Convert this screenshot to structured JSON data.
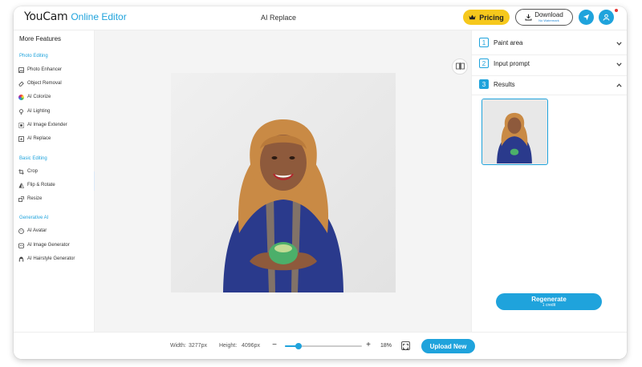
{
  "header": {
    "logo_brand": "YouCam",
    "logo_product": "Online Editor",
    "page_title": "AI Replace",
    "pricing_label": "Pricing",
    "download_label": "Download",
    "download_sub": "No Watermark"
  },
  "sidebar": {
    "title": "More Features",
    "sections": [
      {
        "label": "Photo Editing",
        "items": [
          {
            "label": "Photo Enhancer",
            "icon": "image-icon"
          },
          {
            "label": "Object Removal",
            "icon": "eraser-icon"
          },
          {
            "label": "AI Colorize",
            "icon": "color-wheel-icon"
          },
          {
            "label": "AI Lighting",
            "icon": "lightbulb-icon"
          },
          {
            "label": "AI Image Extender",
            "icon": "expand-icon"
          },
          {
            "label": "AI Replace",
            "icon": "replace-icon"
          }
        ]
      },
      {
        "label": "Basic Editing",
        "items": [
          {
            "label": "Crop",
            "icon": "crop-icon"
          },
          {
            "label": "Flip & Rotate",
            "icon": "flip-icon"
          },
          {
            "label": "Resize",
            "icon": "resize-icon"
          }
        ]
      },
      {
        "label": "Generative AI",
        "items": [
          {
            "label": "AI Avatar",
            "icon": "avatar-icon"
          },
          {
            "label": "AI Image Generator",
            "icon": "image-generator-icon"
          },
          {
            "label": "AI Hairstyle Generator",
            "icon": "hairstyle-icon"
          }
        ]
      }
    ]
  },
  "right_panel": {
    "steps": [
      {
        "number": "1",
        "label": "Paint area",
        "state": "collapsed"
      },
      {
        "number": "2",
        "label": "Input prompt",
        "state": "collapsed"
      },
      {
        "number": "3",
        "label": "Results",
        "state": "expanded"
      }
    ],
    "regenerate_label": "Regenerate",
    "regenerate_sub": "1 credit"
  },
  "bottom_bar": {
    "width_label": "Width:",
    "width_value": "3277px",
    "height_label": "Height:",
    "height_value": "4096px",
    "zoom_minus": "−",
    "zoom_plus": "+",
    "zoom_percent": "18%",
    "zoom_level": 0.18,
    "upload_label": "Upload New"
  },
  "colors": {
    "accent": "#1fa3dc",
    "pricing": "#f6c81c",
    "notification": "#e53935"
  }
}
